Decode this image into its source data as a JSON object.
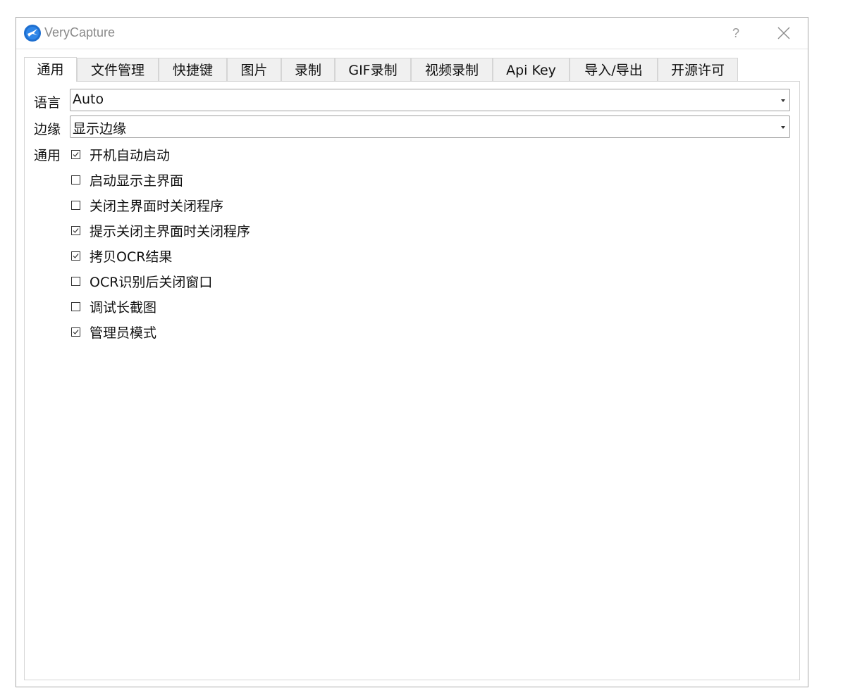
{
  "window": {
    "title": "VeryCapture",
    "help_label": "?"
  },
  "tabs": [
    {
      "label": "通用",
      "active": true
    },
    {
      "label": "文件管理",
      "active": false
    },
    {
      "label": "快捷键",
      "active": false
    },
    {
      "label": "图片",
      "active": false
    },
    {
      "label": "录制",
      "active": false
    },
    {
      "label": "GIF录制",
      "active": false
    },
    {
      "label": "视频录制",
      "active": false
    },
    {
      "label": "Api Key",
      "active": false
    },
    {
      "label": "导入/导出",
      "active": false
    },
    {
      "label": "开源许可",
      "active": false
    }
  ],
  "general": {
    "language_label": "语言",
    "language_value": "Auto",
    "border_label": "边缘",
    "border_value": "显示边缘",
    "general_label": "通用",
    "options": [
      {
        "label": "开机自动启动",
        "checked": true
      },
      {
        "label": "启动显示主界面",
        "checked": false
      },
      {
        "label": "关闭主界面时关闭程序",
        "checked": false
      },
      {
        "label": "提示关闭主界面时关闭程序",
        "checked": true
      },
      {
        "label": "拷贝OCR结果",
        "checked": true
      },
      {
        "label": "OCR识别后关闭窗口",
        "checked": false
      },
      {
        "label": "调试长截图",
        "checked": false
      },
      {
        "label": "管理员模式",
        "checked": true
      }
    ]
  },
  "icons": {
    "app": "verycapture-logo-icon",
    "close": "close-icon",
    "dropdown": "chevron-down-icon",
    "check": "checkmark-icon"
  },
  "colors": {
    "logo_blue": "#1e6fd0",
    "border": "#a9a9a9",
    "tab_bg": "#f0f0f0"
  }
}
